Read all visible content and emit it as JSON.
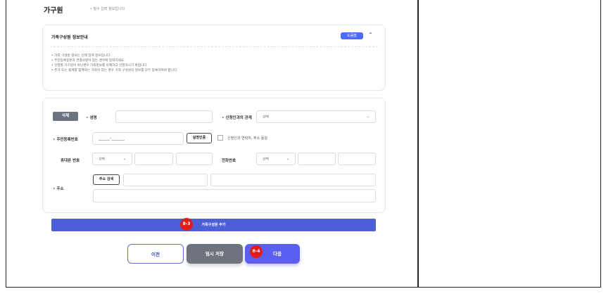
{
  "section": {
    "title": "가구원",
    "required_note": "• 필수 입력 정보입니다."
  },
  "info_panel": {
    "title": "가족구성원 정보안내",
    "help_label": "도움말",
    "notes": [
      "• 가족 구성원 정보는 선택 입력 정보입니다.",
      "• 주민등록등본과 연결사항이 있는 경우에 입력하세요.",
      "• 신청할 가구원이 아닌경우 가족정보를 삭제하고 신청하시기 바랍니다.",
      "• 추가 또는 생계를 함께하는 가족이 있는 경우 가족 구성원의 정보를 모두 등록하여야 합니다."
    ]
  },
  "form": {
    "delete_label": "삭제",
    "name_label": "성명",
    "name_value": "",
    "relation_label": "신청인과의 관계",
    "relation_value": "선택",
    "ssn_label": "주민등록번호",
    "ssn_value": "______-_______",
    "verify_label": "실명인증",
    "same_as_applicant_label": "신청인과 연락처, 주소 동일",
    "mobile_label": "휴대폰 번호",
    "mobile_select": "선택",
    "phone_label": "전화번호",
    "phone_select": "선택",
    "address_label": "주소",
    "address_search_label": "주소 검색"
  },
  "add_member": {
    "label": "가족구성원 추가",
    "badge": "8-3"
  },
  "nav": {
    "prev": "이전",
    "temp_save": "임시 저장",
    "next": "다음",
    "next_badge": "8-4"
  },
  "colors": {
    "primary": "#4c5fd7",
    "badge": "#e21b1b",
    "gray_button": "#6f737d"
  }
}
